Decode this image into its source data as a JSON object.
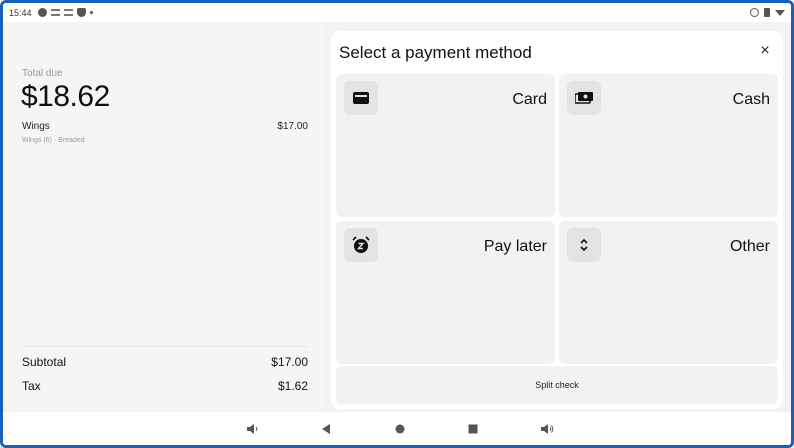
{
  "status_bar": {
    "time": "15:44"
  },
  "order": {
    "total_label": "Total due",
    "total_amount": "$18.62",
    "items": [
      {
        "name": "Wings",
        "price": "$17.00",
        "modifiers": "Wings (6) · Breaded"
      }
    ],
    "subtotal_label": "Subtotal",
    "subtotal_value": "$17.00",
    "tax_label": "Tax",
    "tax_value": "$1.62"
  },
  "payment_sheet": {
    "title": "Select a payment method",
    "close_glyph": "×",
    "methods": [
      {
        "label": "Card",
        "icon": "credit-card-icon"
      },
      {
        "label": "Cash",
        "icon": "cash-icon"
      },
      {
        "label": "Pay later",
        "icon": "alarm-snooze-icon"
      },
      {
        "label": "Other",
        "icon": "unfold-icon"
      }
    ],
    "split_label": "Split check"
  },
  "nav_bar": {
    "icons": [
      "volume-down-icon",
      "back-icon",
      "home-icon",
      "recents-icon",
      "volume-up-icon"
    ]
  },
  "colors": {
    "frame_border": "#1a5fb8",
    "tile_bg": "#f2f2f2",
    "icon_bg": "#e3e3e3"
  }
}
